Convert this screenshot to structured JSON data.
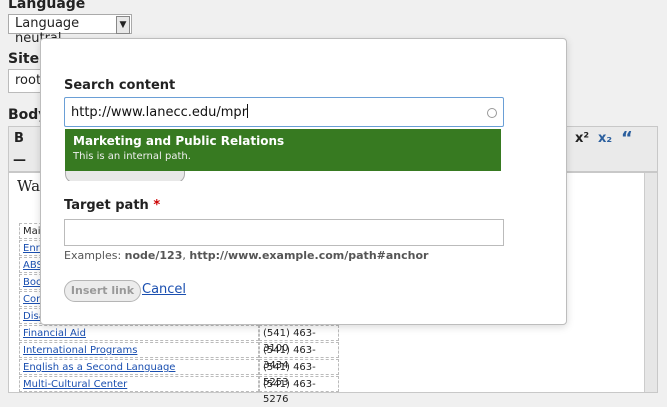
{
  "background": {
    "language_label": "Language",
    "language_value": "Language neutral",
    "site_label": "Site l",
    "site_value": "root",
    "body_label": "Body",
    "toolbar": {
      "bold": "B",
      "superscript": "x²",
      "subscript": "x₂",
      "quote": "“",
      "hr": "—"
    },
    "editor_text": "Wa",
    "table_rows": [
      {
        "name": "Mai",
        "phone": ""
      },
      {
        "name": "Enro",
        "phone": ""
      },
      {
        "name": "ABS",
        "phone": ""
      },
      {
        "name": "Boo",
        "phone": ""
      },
      {
        "name": "Con",
        "phone": ""
      },
      {
        "name": "Disa",
        "phone": ""
      },
      {
        "name": "Financial Aid",
        "phone": "(541) 463-3100"
      },
      {
        "name": "International Programs",
        "phone": "(541) 463-3434"
      },
      {
        "name": "English as a Second Language",
        "phone": "(541) 463-5253"
      },
      {
        "name": "Multi-Cultural Center",
        "phone": "(541) 463-5276"
      }
    ]
  },
  "dialog": {
    "search_label": "Search content",
    "search_value": "http://www.lanecc.edu/mpr",
    "autocomplete": {
      "title": "Marketing and Public Relations",
      "description": "This is an internal path."
    },
    "target_label": "Target path",
    "required_mark": "*",
    "target_value": "",
    "examples_prefix": "Examples: ",
    "example_1": "node/123",
    "example_sep": ", ",
    "example_2": "http://www.example.com/path#anchor",
    "insert_label": "Insert link",
    "cancel_label": "Cancel"
  },
  "colors": {
    "autocomplete_bg": "#377a21",
    "link": "#1a4fb0",
    "required": "#cc0000"
  }
}
